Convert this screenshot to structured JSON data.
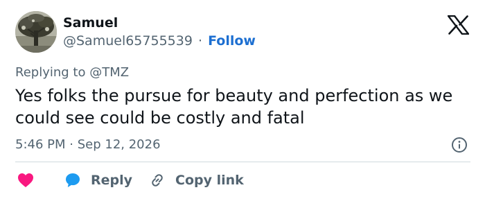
{
  "author": {
    "name": "Samuel",
    "handle": "@Samuel65755539",
    "separator": "·",
    "follow_label": "Follow",
    "avatar_icon": "tree-avatar"
  },
  "brand": {
    "logo_icon": "x-logo-icon"
  },
  "tweet": {
    "replying_prefix": "Replying to",
    "replying_to": "@TMZ",
    "text": "Yes folks the pursue for beauty and perfection as we could see could be costly and fatal",
    "time": "5:46 PM",
    "date_separator": "·",
    "date": "Sep 12, 2026",
    "info_icon": "info-icon"
  },
  "actions": {
    "like_icon": "heart-icon",
    "reply_icon": "speech-bubble-icon",
    "reply_label": "Reply",
    "copy_icon": "link-icon",
    "copy_label": "Copy link"
  },
  "colors": {
    "text_primary": "#0f1419",
    "text_secondary": "#536471",
    "link_blue": "#1d6fd1",
    "heart_pink": "#f91880",
    "reply_blue": "#1d9bf0",
    "divider": "#cfd9de"
  }
}
